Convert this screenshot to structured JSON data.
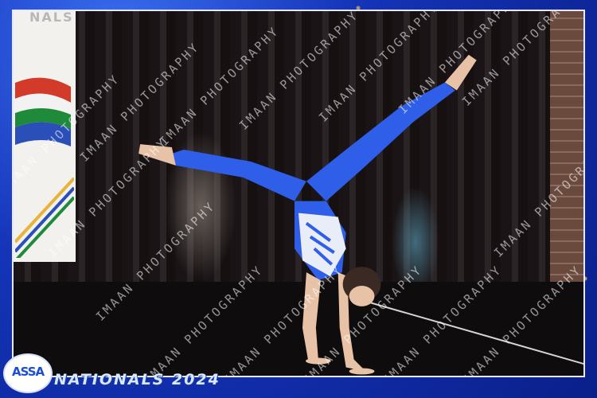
{
  "event": {
    "title": "NATIONALS 2024",
    "logo_text": "ASSA",
    "banner_text": "NALS"
  },
  "watermark": {
    "text": "IMAAN PHOTOGRAPHY"
  },
  "colors": {
    "frame_blue": "#1534b8",
    "leotard_blue": "#2f5fe8",
    "sparkle_gold": "#ffd750"
  }
}
